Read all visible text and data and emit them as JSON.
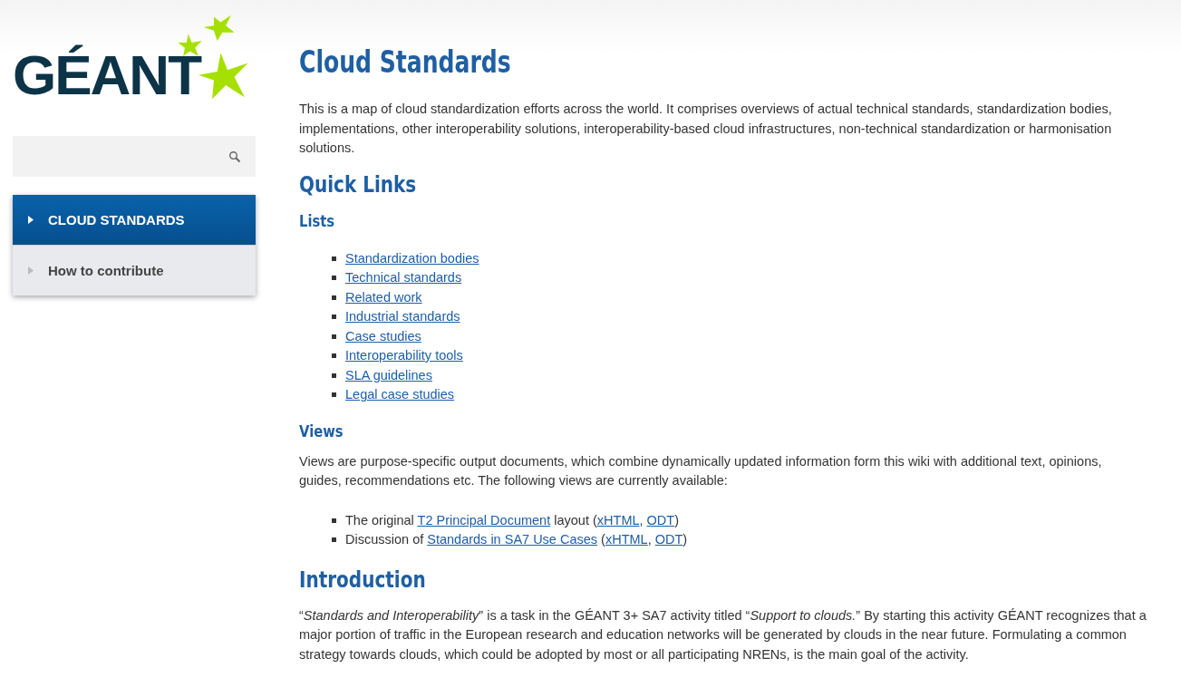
{
  "logo": "GÉANT",
  "nav": [
    {
      "label": "CLOUD STANDARDS",
      "selected": true
    },
    {
      "label": "How to contribute",
      "selected": false
    }
  ],
  "title": "Cloud Standards",
  "intro": "This is a map of cloud standardization efforts across the world. It comprises overviews of actual technical standards, standardization bodies, implementations, other interoperability solutions, interoperability-based cloud infrastructures, non-technical standardization or harmonisation solutions.",
  "quick_links": {
    "heading": "Quick Links",
    "lists_heading": "Lists",
    "lists": [
      "Standardization bodies",
      "Technical standards",
      "Related work",
      "Industrial standards",
      "Case studies",
      "Interoperability tools",
      "SLA guidelines",
      "Legal case studies"
    ],
    "views_heading": "Views",
    "views_text": "Views are purpose-specific output documents, which combine dynamically updated information form this wiki with additional text, opinions, guides, recommendations etc. The following views are currently available:",
    "views": [
      [
        {
          "kind": "text",
          "text": "The original "
        },
        {
          "kind": "link",
          "text": "T2 Principal Document"
        },
        {
          "kind": "text",
          "text": " layout ("
        },
        {
          "kind": "link",
          "text": "xHTML"
        },
        {
          "kind": "text",
          "text": ", "
        },
        {
          "kind": "link",
          "text": "ODT"
        },
        {
          "kind": "text",
          "text": ")"
        }
      ],
      [
        {
          "kind": "text",
          "text": "Discussion of "
        },
        {
          "kind": "link",
          "text": "Standards in SA7 Use Cases"
        },
        {
          "kind": "text",
          "text": " ("
        },
        {
          "kind": "link",
          "text": "xHTML"
        },
        {
          "kind": "text",
          "text": ", "
        },
        {
          "kind": "link",
          "text": "ODT"
        },
        {
          "kind": "text",
          "text": ")"
        }
      ]
    ]
  },
  "introduction": {
    "heading": "Introduction",
    "text": "“*Standards and Interoperability*” is a task in the GÉANT 3+ SA7 activity titled “*Support to clouds.*” By starting this activity GÉANT recognizes that a major portion of traffic in the European research and education networks will be generated by clouds in the near future. Formulating a common strategy towards clouds, which could be adopted by most or all participating NRENs, is the main goal of the activity."
  }
}
